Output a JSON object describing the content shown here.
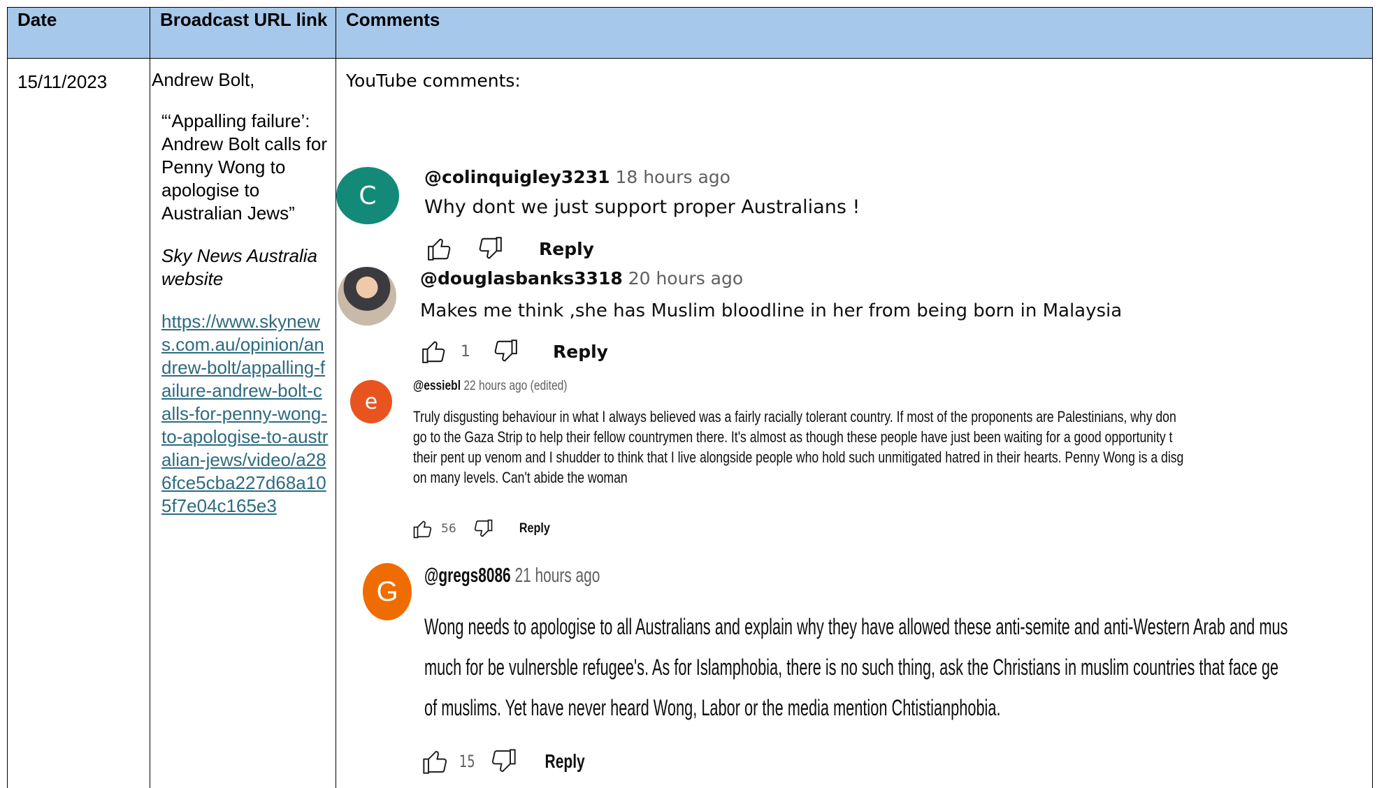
{
  "table": {
    "headers": {
      "date": "Date",
      "broadcast": "Broadcast URL link",
      "comments": "Comments"
    },
    "row": {
      "date": "15/11/2023",
      "broadcaster": "Andrew Bolt,",
      "title": "“‘Appalling failure’: Andrew Bolt calls for Penny Wong to apologise to Australian Jews”",
      "source": "Sky News Australia website",
      "url": "https://www.skynews.com.au/opinion/andrew-bolt/appalling-failure-andrew-bolt-calls-for-penny-wong-to-apologise-to-australian-jews/video/a286fce5cba227d68a105f7e04c165e3"
    },
    "comments_intro": "YouTube comments:"
  },
  "comments": [
    {
      "avatar_letter": "C",
      "avatar_color": "#138a78",
      "handle": "@colinquigley3231",
      "time": "18 hours ago",
      "lines": [
        "Why dont we just support proper Australians !"
      ],
      "likes": "",
      "reply": "Reply"
    },
    {
      "avatar_letter": "",
      "avatar_color": "#6b7c8f",
      "handle": "@douglasbanks3318",
      "time": "20 hours ago",
      "lines": [
        "Makes me think ,she has Muslim bloodline in her from being born in Malaysia"
      ],
      "likes": "1",
      "reply": "Reply"
    },
    {
      "avatar_letter": "e",
      "avatar_color": "#e8541f",
      "handle": "@essiebl",
      "time": "22 hours ago (edited)",
      "lines": [
        "Truly disgusting behaviour in what I always believed was a fairly racially tolerant country.  If most of the proponents are Palestinians, why don",
        "go to the Gaza Strip to help their fellow countrymen there.  It's almost as though these people have just been waiting for a good opportunity t",
        "their pent up venom and I shudder to think that I live alongside people who hold such unmitigated hatred in their hearts. Penny Wong is a disg",
        "on many levels. Can't abide the woman"
      ],
      "likes": "56",
      "reply": "Reply"
    },
    {
      "avatar_letter": "G",
      "avatar_color": "#ef6c00",
      "handle": "@gregs8086",
      "time": "21 hours ago",
      "lines": [
        "Wong needs to apologise to all Australians and explain why they have allowed these anti-semite and anti-Western Arab and mus",
        "much for be vulnersble refugee's.  As for Islamphobia, there is no such thing, ask the Christians in muslim countries that face ge",
        "of muslims.  Yet have never heard Wong, Labor or the media mention Chtistianphobia."
      ],
      "likes": "15",
      "reply": "Reply"
    }
  ],
  "icons": {
    "like": "thumbs-up-icon",
    "dislike": "thumbs-down-icon"
  }
}
